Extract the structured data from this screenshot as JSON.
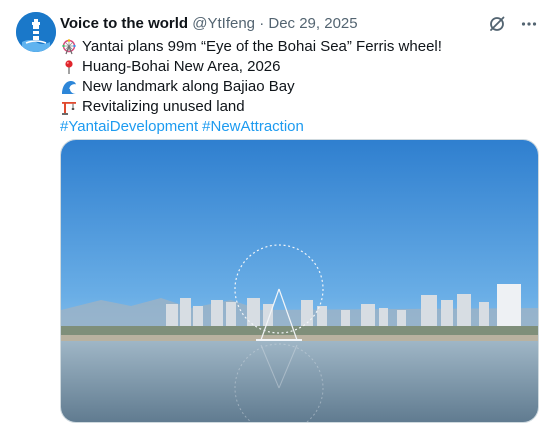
{
  "post": {
    "display_name": "Voice to the world",
    "handle": "@YtIfeng",
    "separator": "·",
    "date": "Dec 29, 2025",
    "lines": [
      {
        "icon": "ferris-wheel-icon",
        "text": "Yantai plans 99m “Eye of the Bohai Sea” Ferris wheel!"
      },
      {
        "icon": "pin-icon",
        "text": "Huang-Bohai New Area, 2026"
      },
      {
        "icon": "wave-icon",
        "text": "New landmark along Bajiao Bay"
      },
      {
        "icon": "crane-icon",
        "text": "Revitalizing unused land"
      }
    ],
    "hashtags": [
      "#YantaiDevelopment",
      "#NewAttraction"
    ]
  },
  "colors": {
    "link": "#1d9bf0",
    "secondary_text": "#536471",
    "avatar_bg": "#1a78c9"
  },
  "icons": {
    "grok": "grok-icon",
    "more": "more-icon"
  }
}
